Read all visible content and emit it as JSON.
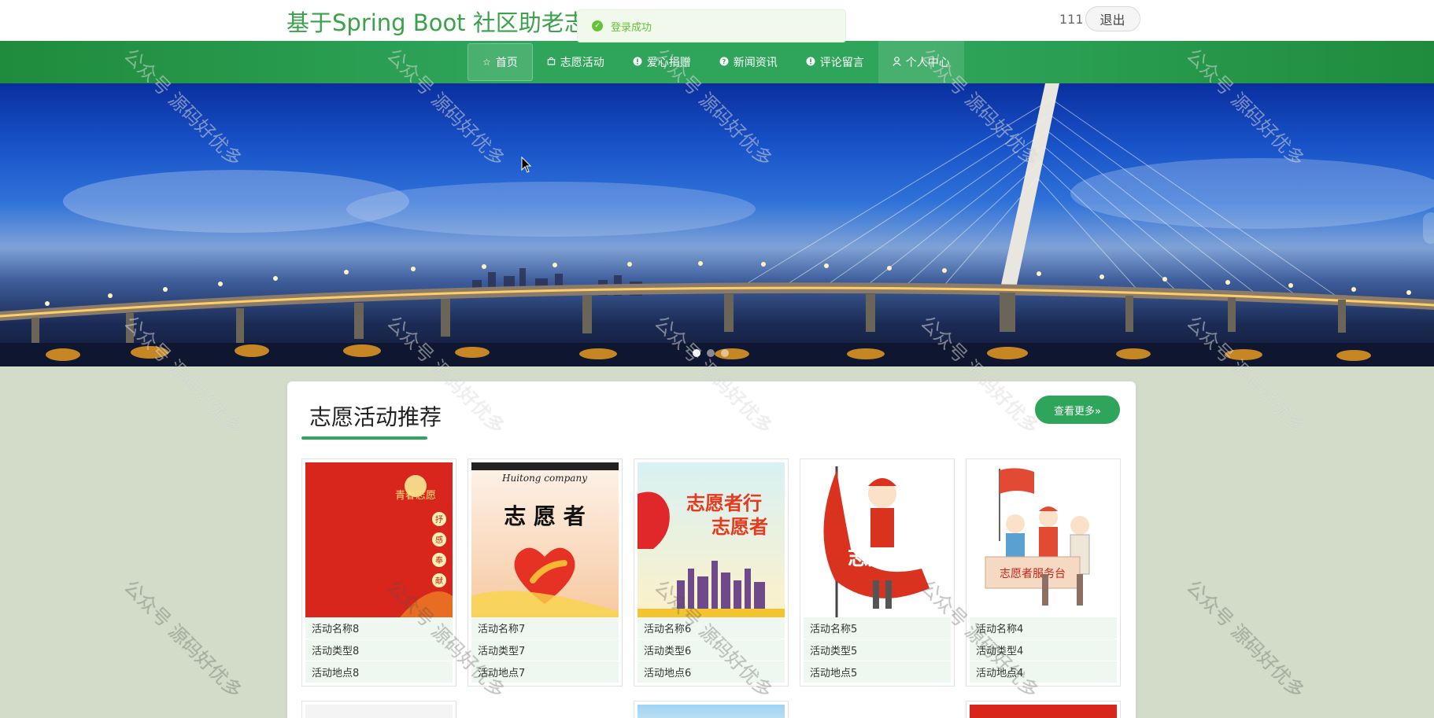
{
  "header": {
    "site_title": "基于Spring Boot 社区助老志愿",
    "username": "111",
    "logout_label": "退出"
  },
  "toast": {
    "message": "登录成功"
  },
  "nav": {
    "items": [
      {
        "label": "首页",
        "icon": "star-icon"
      },
      {
        "label": "志愿活动",
        "icon": "bag-icon"
      },
      {
        "label": "爱心捐赠",
        "icon": "info-icon"
      },
      {
        "label": "新闻资讯",
        "icon": "question-icon"
      },
      {
        "label": "评论留言",
        "icon": "info-icon"
      },
      {
        "label": "个人中心",
        "icon": "user-icon"
      }
    ]
  },
  "section": {
    "title": "志愿活动推荐",
    "more_label": "查看更多»"
  },
  "activities": [
    {
      "name": "活动名称8",
      "type": "活动类型8",
      "location": "活动地点8"
    },
    {
      "name": "活动名称7",
      "type": "活动类型7",
      "location": "活动地点7"
    },
    {
      "name": "活动名称6",
      "type": "活动类型6",
      "location": "活动地点6"
    },
    {
      "name": "活动名称5",
      "type": "活动类型5",
      "location": "活动地点5"
    },
    {
      "name": "活动名称4",
      "type": "活动类型4",
      "location": "活动地点4"
    }
  ],
  "posters": {
    "p7_company": "Huitong company",
    "p7_title": "志 愿 者",
    "p6_line1": "志愿者行",
    "p6_line2": "志愿者",
    "p5_text": "志愿者",
    "p4_desk": "志愿者服务台",
    "p8_badge": "青春志愿",
    "p8_vertical": [
      "抒",
      "感",
      "奉",
      "献"
    ]
  },
  "watermark": "公众号 源码好优多",
  "colors": {
    "brand_green": "#2ea55a",
    "title_green": "#3aa24a",
    "toast_green": "#67c23a"
  }
}
